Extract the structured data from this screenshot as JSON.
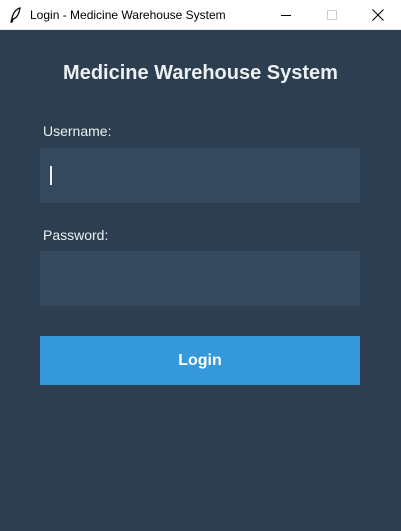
{
  "window": {
    "title": "Login - Medicine Warehouse System",
    "app_icon": "feather-icon",
    "controls": [
      "minimize-icon",
      "maximize-icon",
      "close-icon"
    ]
  },
  "form": {
    "heading": "Medicine Warehouse System",
    "username_label": "Username:",
    "username_value": "",
    "password_label": "Password:",
    "password_value": "",
    "login_label": "Login"
  },
  "colors": {
    "background": "#2c3e50",
    "field": "#34495e",
    "button": "#3498db",
    "text": "#ecf0f1"
  }
}
